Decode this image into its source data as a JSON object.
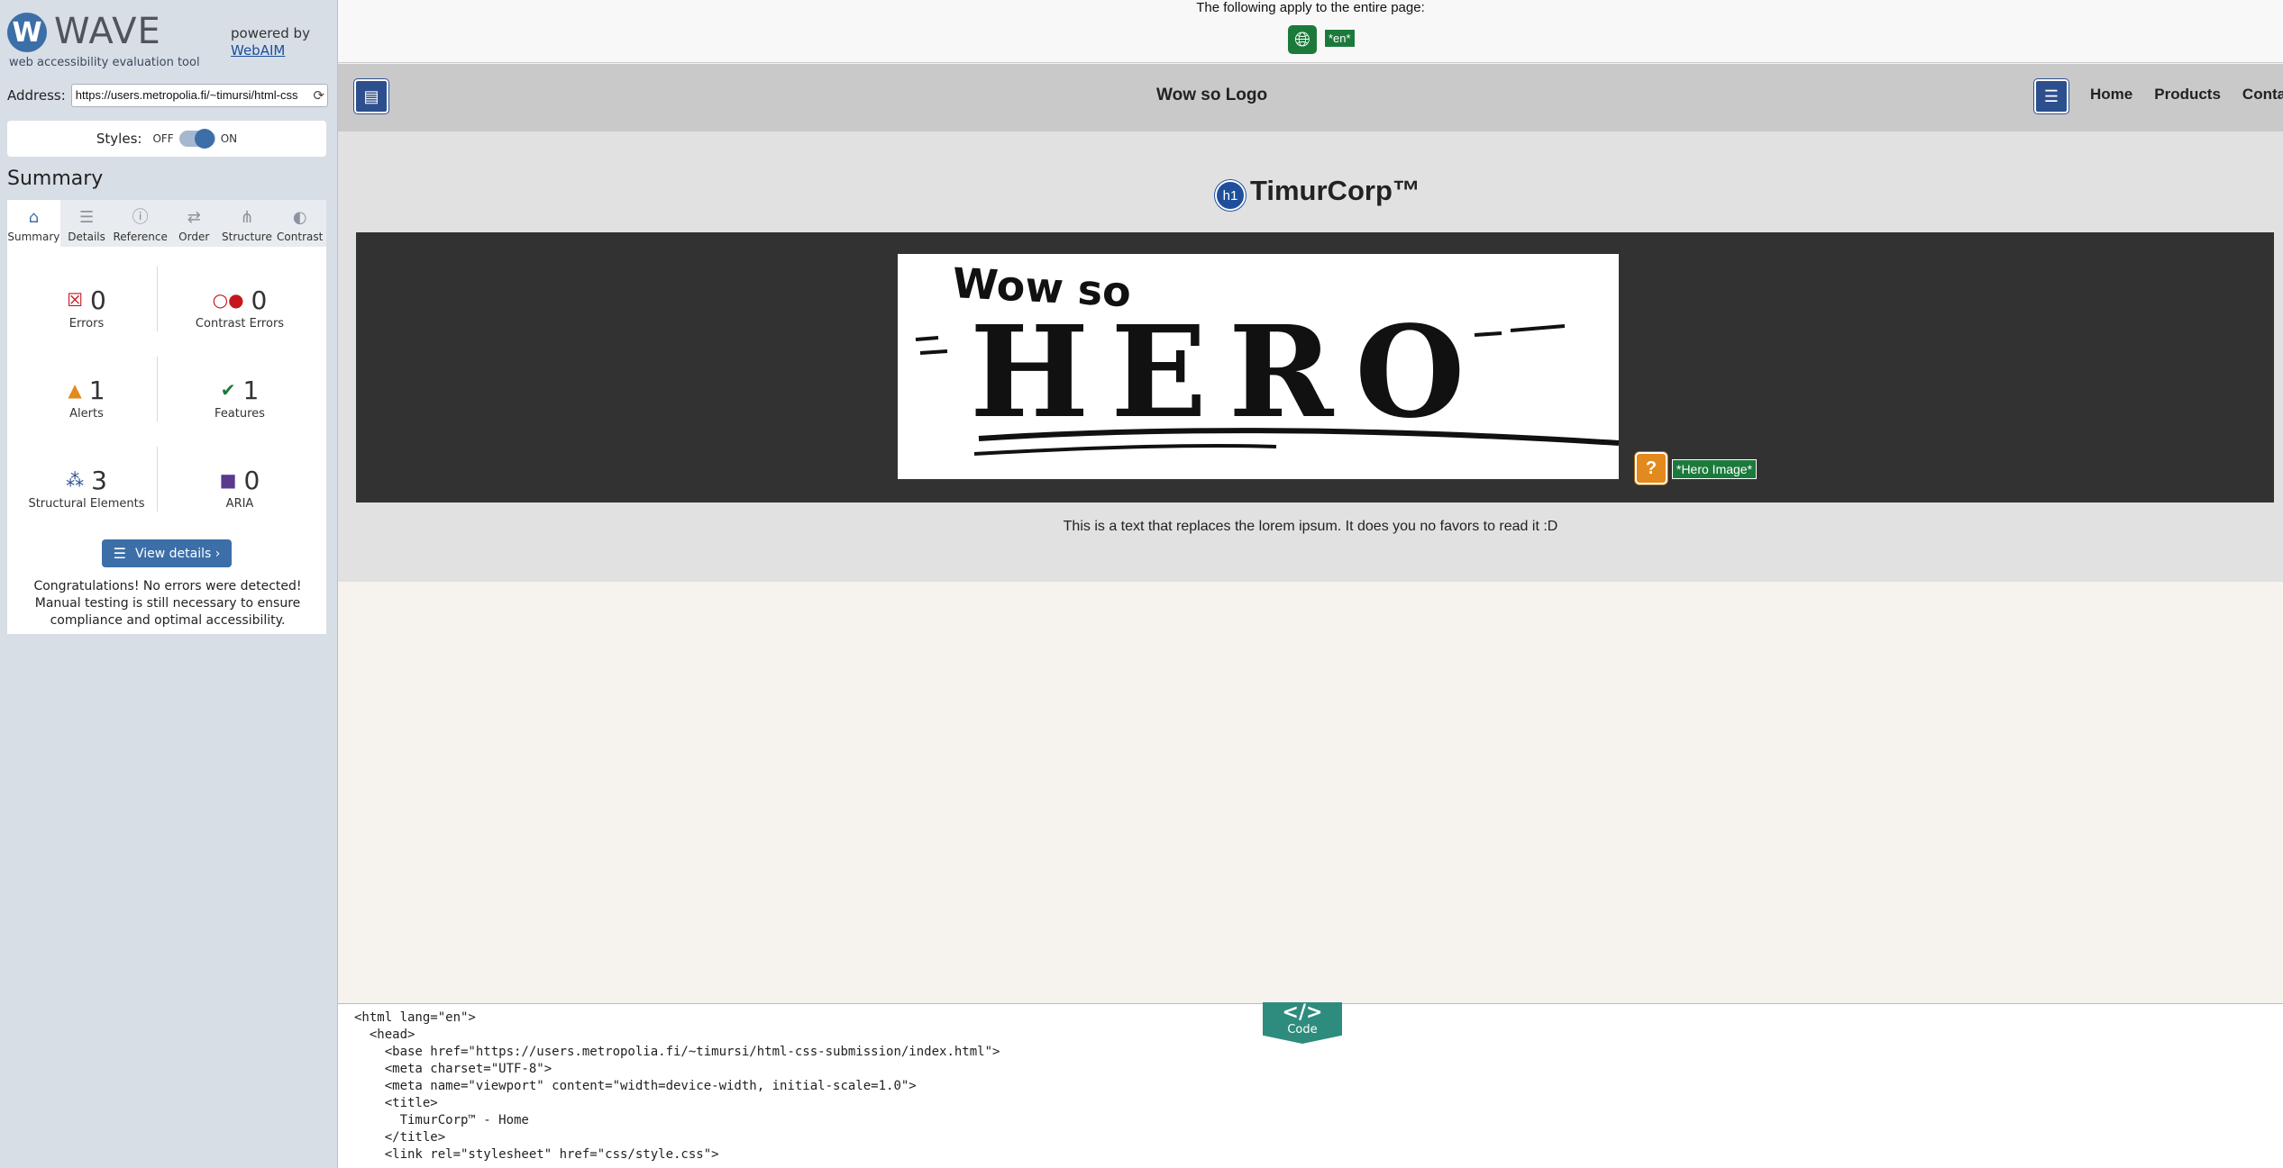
{
  "wave": {
    "logo_letter": "W",
    "logo_name": "WAVE",
    "logo_subtitle": "web accessibility evaluation tool",
    "powered_by": "powered by",
    "powered_link": "WebAIM",
    "address_label": "Address:",
    "address_value": "https://users.metropolia.fi/~timursi/html-css",
    "styles_label": "Styles:",
    "styles_off": "OFF",
    "styles_on": "ON",
    "summary_heading": "Summary",
    "tabs": [
      {
        "label": "Summary",
        "icon": "home-icon",
        "active": true
      },
      {
        "label": "Details",
        "icon": "list-icon"
      },
      {
        "label": "Reference",
        "icon": "info-icon"
      },
      {
        "label": "Order",
        "icon": "order-icon"
      },
      {
        "label": "Structure",
        "icon": "structure-icon"
      },
      {
        "label": "Contrast",
        "icon": "contrast-icon"
      }
    ],
    "stats": {
      "errors": {
        "value": "0",
        "label": "Errors",
        "color": "#c5161d"
      },
      "contrast_errors": {
        "value": "0",
        "label": "Contrast Errors",
        "color": "#c5161d"
      },
      "alerts": {
        "value": "1",
        "label": "Alerts",
        "color": "#e28a1e"
      },
      "features": {
        "value": "1",
        "label": "Features",
        "color": "#1b7a3b"
      },
      "structural": {
        "value": "3",
        "label": "Structural Elements",
        "color": "#2d4f8e"
      },
      "aria": {
        "value": "0",
        "label": "ARIA",
        "color": "#5a3a8f"
      }
    },
    "view_details_label": "View details ›",
    "congrats_text": "Congratulations! No errors were detected! Manual testing is still necessary to ensure compliance and optimal accessibility."
  },
  "page": {
    "notice_text": "The following apply to the entire page:",
    "lang_badge": "*en*",
    "site_logo_text": "Wow so Logo",
    "nav": [
      "Home",
      "Products",
      "Contact"
    ],
    "h1_badge": "h1",
    "h1_text": "TimurCorp™",
    "hero_image_text": "HERO",
    "hero_image_top_text": "Wow so",
    "alert_icon": "?",
    "alt_badge": "*Hero Image*",
    "body_text": "This is a text that replaces the lorem ipsum. It does you no favors to read it :D"
  },
  "code": {
    "tab_icon": "</>",
    "tab_label": "Code",
    "lines": [
      "<html lang=\"en\">",
      "  <head>",
      "    <base href=\"https://users.metropolia.fi/~timursi/html-css-submission/index.html\">",
      "    <meta charset=\"UTF-8\">",
      "    <meta name=\"viewport\" content=\"width=device-width, initial-scale=1.0\">",
      "    <title>",
      "      TimurCorp™ - Home",
      "    </title>",
      "    <link rel=\"stylesheet\" href=\"css/style.css\">"
    ]
  }
}
